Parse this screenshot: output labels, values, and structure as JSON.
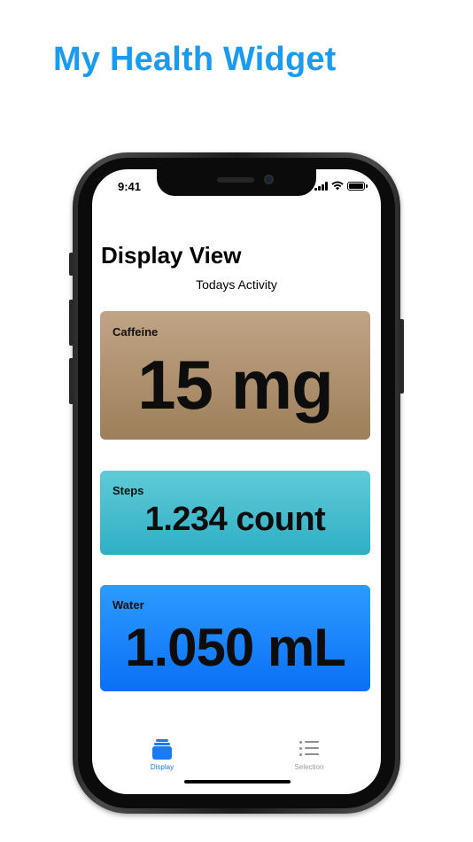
{
  "promo": {
    "title": "My Health Widget"
  },
  "status_bar": {
    "time": "9:41"
  },
  "nav": {
    "title": "Display View",
    "subtitle": "Todays Activity"
  },
  "cards": [
    {
      "label": "Caffeine",
      "value": "15 mg",
      "color_top": "#c0a486",
      "color_bottom": "#9d7f59"
    },
    {
      "label": "Steps",
      "value": "1.234 count",
      "color_top": "#5fcbd8",
      "color_bottom": "#2fafc4"
    },
    {
      "label": "Water",
      "value": "1.050 mL",
      "color_top": "#2d9bff",
      "color_bottom": "#0a70f6"
    }
  ],
  "tabs": [
    {
      "label": "Display",
      "icon": "stack-icon",
      "selected": true
    },
    {
      "label": "Selection",
      "icon": "list-icon",
      "selected": false
    }
  ],
  "colors": {
    "accent": "#1a7cf5",
    "promo_title": "#1a9bf0",
    "inactive": "#9a9a9a"
  }
}
